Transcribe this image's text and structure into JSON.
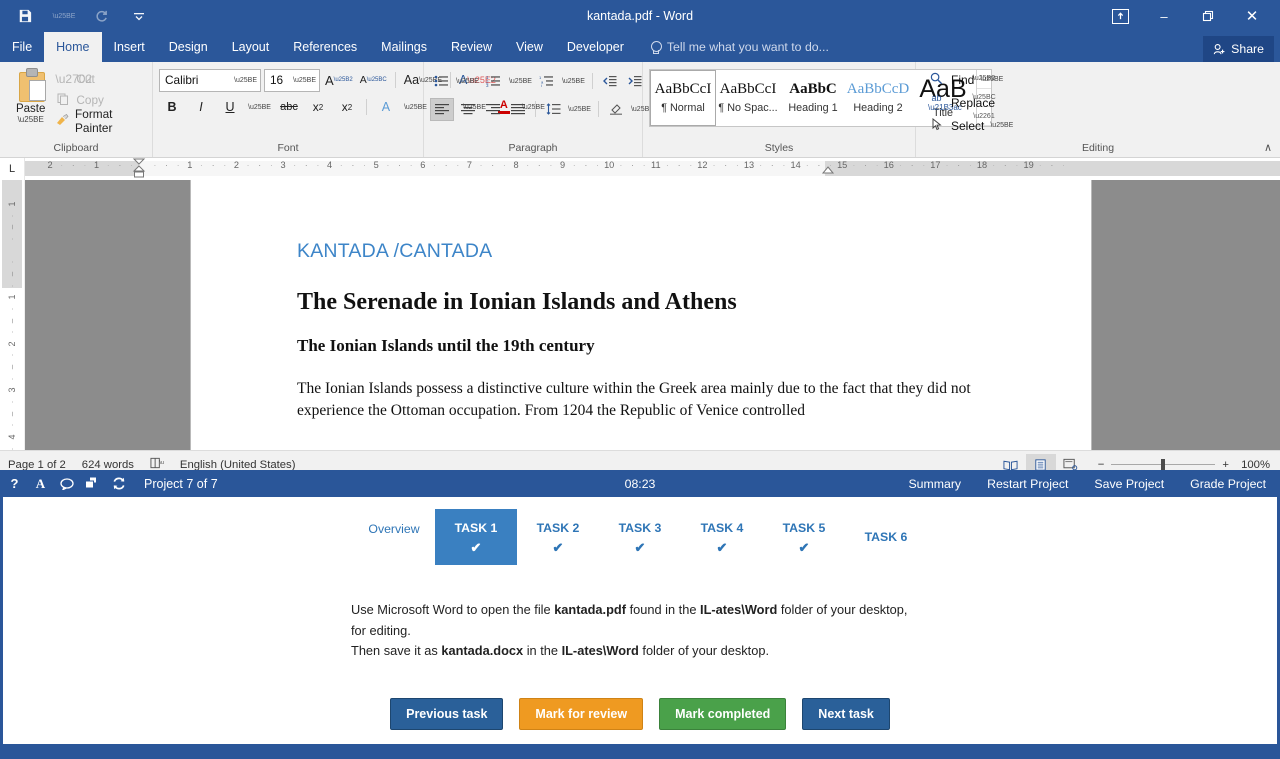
{
  "window": {
    "title": "kantada.pdf - Word",
    "quick_access": [
      {
        "name": "save-icon",
        "glyph": "💾"
      },
      {
        "name": "undo-icon",
        "glyph": "↶"
      },
      {
        "name": "redo-icon",
        "glyph": "↻"
      },
      {
        "name": "customize-qat-icon",
        "glyph": "∴"
      }
    ],
    "controls": {
      "ribbon_display_label": "↑",
      "minimize_label": "–",
      "restore_label": "❐",
      "close_label": "✕"
    }
  },
  "ribbon": {
    "tabs": [
      "File",
      "Home",
      "Insert",
      "Design",
      "Layout",
      "References",
      "Mailings",
      "Review",
      "View",
      "Developer"
    ],
    "active_tab": "Home",
    "tellme_placeholder": "Tell me what you want to do...",
    "share_label": "Share",
    "collapse_label": "∧",
    "groups": {
      "clipboard": {
        "label": "Clipboard",
        "paste_label": "Paste",
        "items": [
          {
            "label": "Cut",
            "icon": "scissors-icon",
            "glyph": "✂"
          },
          {
            "label": "Copy",
            "icon": "copy-icon",
            "glyph": "❐"
          },
          {
            "label": "Format Painter",
            "icon": "format-painter-icon",
            "glyph": "🖌"
          }
        ]
      },
      "font": {
        "label": "Font",
        "font_name": "Calibri",
        "font_size": "16",
        "buttons": [
          {
            "name": "grow-font",
            "label": "A"
          },
          {
            "name": "shrink-font",
            "label": "A"
          },
          {
            "name": "change-case",
            "label": "Aa"
          },
          {
            "name": "clear-formatting",
            "label": "A"
          },
          {
            "name": "bold",
            "label": "B"
          },
          {
            "name": "italic",
            "label": "I"
          },
          {
            "name": "underline",
            "label": "U"
          },
          {
            "name": "strikethrough",
            "label": "abc"
          },
          {
            "name": "subscript",
            "label": "x₂"
          },
          {
            "name": "superscript",
            "label": "x²"
          },
          {
            "name": "text-effects",
            "label": "A"
          },
          {
            "name": "text-highlight",
            "label": "ab"
          },
          {
            "name": "font-color",
            "label": "A"
          }
        ]
      },
      "paragraph": {
        "label": "Paragraph",
        "buttons": [
          {
            "name": "bullets",
            "label": "•–"
          },
          {
            "name": "numbering",
            "label": "1–"
          },
          {
            "name": "multilevel-list",
            "label": "a–"
          },
          {
            "name": "decrease-indent",
            "label": "←≡"
          },
          {
            "name": "increase-indent",
            "label": "→≡"
          },
          {
            "name": "sort",
            "label": "A↓"
          },
          {
            "name": "show-formatting-marks",
            "label": "¶"
          },
          {
            "name": "align-left",
            "label": "≡"
          },
          {
            "name": "align-center",
            "label": "≡"
          },
          {
            "name": "align-right",
            "label": "≡"
          },
          {
            "name": "justify",
            "label": "≡"
          },
          {
            "name": "line-spacing",
            "label": "↕≡"
          },
          {
            "name": "shading",
            "label": "▤"
          },
          {
            "name": "borders",
            "label": "⊞"
          }
        ]
      },
      "styles": {
        "label": "Styles",
        "items": [
          {
            "preview": "AaBbCcI",
            "label": "¶ Normal",
            "selected": true,
            "kind": "normal"
          },
          {
            "preview": "AaBbCcI",
            "label": "¶ No Spac...",
            "selected": false,
            "kind": "normal"
          },
          {
            "preview": "AaBbC",
            "label": "Heading 1",
            "selected": false,
            "kind": "h1"
          },
          {
            "preview": "AaBbCcD",
            "label": "Heading 2",
            "selected": false,
            "kind": "h2"
          },
          {
            "preview": "AaB",
            "label": "Title",
            "selected": false,
            "kind": "title"
          }
        ]
      },
      "editing": {
        "label": "Editing",
        "items": [
          {
            "label": "Find",
            "icon": "search-icon",
            "glyph": "🔍",
            "caret": true
          },
          {
            "label": "Replace",
            "icon": "replace-icon",
            "glyph": "ab",
            "caret": false
          },
          {
            "label": "Select",
            "icon": "select-icon",
            "glyph": "↖",
            "caret": true
          }
        ]
      }
    }
  },
  "ruler": {
    "tab_selector": "L",
    "horizontal_marks": [
      "2",
      "1",
      "1",
      "2",
      "3",
      "4",
      "5",
      "6",
      "7",
      "8",
      "9",
      "10",
      "11",
      "12",
      "13",
      "14",
      "15",
      "16",
      "17",
      "18",
      "19"
    ],
    "vertical_marks": [
      "1",
      "1",
      "2",
      "3",
      "4"
    ]
  },
  "document": {
    "heading_blue": "KANTADA /CANTADA",
    "title": "The Serenade in Ionian Islands and Athens",
    "subtitle": "The Ionian Islands until the 19th century",
    "paragraph": "The Ionian Islands possess a distinctive culture within the Greek area mainly due to the fact that they did not experience the Ottoman occupation. From 1204 the Republic of Venice controlled"
  },
  "status_bar": {
    "page": "Page 1 of 2",
    "words": "624 words",
    "proofing_icon": "spellcheck-icon",
    "language": "English (United States)",
    "views": [
      {
        "name": "read-mode-view",
        "glyph": "📖",
        "active": false
      },
      {
        "name": "print-layout-view",
        "glyph": "▤",
        "active": true
      },
      {
        "name": "web-layout-view",
        "glyph": "▦",
        "active": false
      }
    ],
    "zoom_out": "−",
    "zoom_in": "+",
    "zoom_level": "100%"
  },
  "task_bar": {
    "icons": [
      {
        "name": "help-icon",
        "glyph": "?"
      },
      {
        "name": "font-icon",
        "glyph": "A"
      },
      {
        "name": "comment-icon",
        "glyph": "🗩"
      },
      {
        "name": "windows-icon",
        "glyph": "⧉"
      },
      {
        "name": "refresh-icon",
        "glyph": "↻"
      }
    ],
    "project": "Project 7 of 7",
    "time": "08:23",
    "actions": [
      "Summary",
      "Restart Project",
      "Save Project",
      "Grade Project"
    ]
  },
  "task_panel": {
    "tabs": [
      {
        "label": "Overview",
        "selected": false,
        "completed": false
      },
      {
        "label": "TASK 1",
        "selected": true,
        "completed": true
      },
      {
        "label": "TASK 2",
        "selected": false,
        "completed": true
      },
      {
        "label": "TASK 3",
        "selected": false,
        "completed": true
      },
      {
        "label": "TASK 4",
        "selected": false,
        "completed": true
      },
      {
        "label": "TASK 5",
        "selected": false,
        "completed": true
      },
      {
        "label": "TASK 6",
        "selected": false,
        "completed": false
      }
    ],
    "check_glyph": "✔",
    "instructions": {
      "line1_a": "Use Microsoft Word to open the file ",
      "line1_b": "kantada.pdf",
      "line1_c": " found in the ",
      "line1_d": "IL-ates\\Word",
      "line1_e": " folder of your desktop,",
      "line2": "for editing.",
      "line3_a": "Then save it as ",
      "line3_b": "kantada.docx",
      "line3_c": " in the ",
      "line3_d": "IL-ates\\Word",
      "line3_e": " folder of your desktop."
    },
    "buttons": [
      {
        "label": "Previous task",
        "style": "blue"
      },
      {
        "label": "Mark for review",
        "style": "orange"
      },
      {
        "label": "Mark completed",
        "style": "green"
      },
      {
        "label": "Next task",
        "style": "blue"
      }
    ]
  },
  "colors": {
    "word_blue": "#2b579a",
    "panel_blue": "#2a5699",
    "tab_selected": "#3a80c1",
    "tab_text": "#2e75b6",
    "orange": "#ef9a21",
    "green": "#4aa14a",
    "doc_heading_blue": "#3d85c8"
  }
}
